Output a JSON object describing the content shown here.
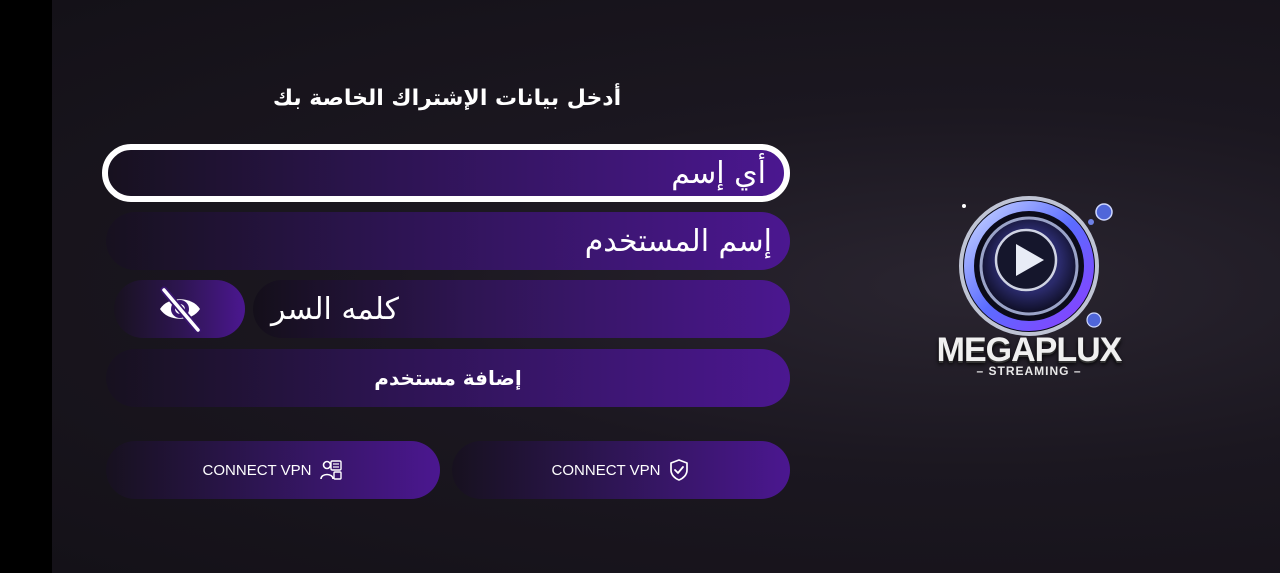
{
  "form": {
    "title": "أدخل بيانات الإشتراك الخاصة بك",
    "name_field": "أي إسم",
    "username_field": "إسم المستخدم",
    "password_field": "كلمه السر",
    "add_user_label": "إضافة مستخدم"
  },
  "vpn": {
    "left_label": "CONNECT VPN",
    "right_label": "CONNECT VPN"
  },
  "logo": {
    "brand": "MEGAPLUX",
    "subtitle": "– STREAMING –"
  },
  "colors": {
    "accent": "#4b1790",
    "background": "#1b1720"
  }
}
